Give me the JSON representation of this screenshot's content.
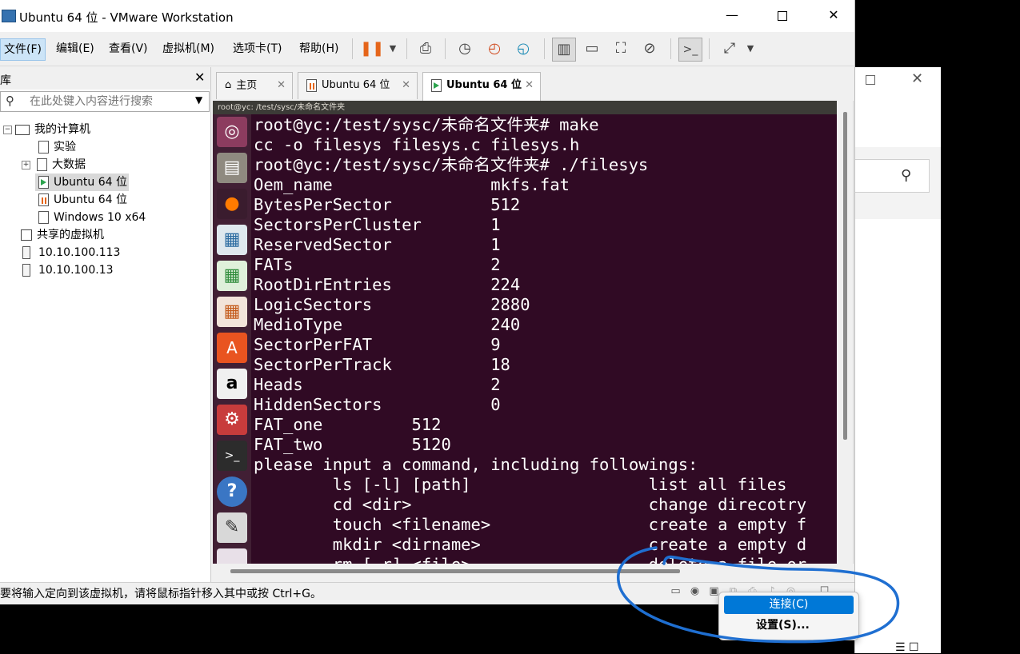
{
  "window": {
    "title": "Ubuntu 64 位 - VMware Workstation",
    "controls": {
      "minimize": "—",
      "close": "✕"
    }
  },
  "menu": {
    "file": "文件(F)",
    "edit": "编辑(E)",
    "view": "查看(V)",
    "vm": "虚拟机(M)",
    "tabs": "选项卡(T)",
    "help": "帮助(H)"
  },
  "library": {
    "title": "库",
    "search_placeholder": "在此处键入内容进行搜索",
    "items": [
      {
        "label": "我的计算机"
      },
      {
        "label": "实验"
      },
      {
        "label": "大数据"
      },
      {
        "label": "Ubuntu 64 位"
      },
      {
        "label": "Ubuntu 64 位"
      },
      {
        "label": "Windows 10 x64"
      },
      {
        "label": "共享的虚拟机"
      },
      {
        "label": "10.10.100.113"
      },
      {
        "label": "10.10.100.13"
      }
    ]
  },
  "tabs": [
    {
      "label": "主页"
    },
    {
      "label": "Ubuntu 64 位"
    },
    {
      "label": "Ubuntu 64 位"
    }
  ],
  "vm_display": {
    "topbar_text": "root@yc: /test/sysc/未命名文件夹",
    "terminal_lines": [
      "root@yc:/test/sysc/未命名文件夹# make",
      "cc -o filesys filesys.c filesys.h",
      "root@yc:/test/sysc/未命名文件夹# ./filesys",
      "Oem_name                mkfs.fat",
      "BytesPerSector          512",
      "SectorsPerCluster       1",
      "ReservedSector          1",
      "FATs                    2",
      "RootDirEntries          224",
      "LogicSectors            2880",
      "MedioType               240",
      "SectorPerFAT            9",
      "SectorPerTrack          18",
      "Heads                   2",
      "HiddenSectors           0",
      "FAT_one         512",
      "FAT_two         5120",
      "please input a command, including followings:",
      "        ls [-l] [path]                  list all files",
      "        cd <dir>                        change direcotry",
      "        touch <filename>                create a empty f",
      "        mkdir <dirname>                 create a empty d",
      "        rm [-r] <file>                  delete a file or"
    ]
  },
  "status_bar": {
    "message": "要将输入定向到该虚拟机，请将鼠标指针移入其中或按 Ctrl+G。"
  },
  "context_menu": {
    "items": [
      {
        "label": "连接(C)",
        "highlighted": true
      },
      {
        "label": "设置(S)..."
      }
    ]
  },
  "colors": {
    "terminal_bg": "#300a24",
    "launcher_bg": "#411f34",
    "menu_highlight": "#0078d7",
    "annotation_stroke": "#1f6fd1"
  }
}
